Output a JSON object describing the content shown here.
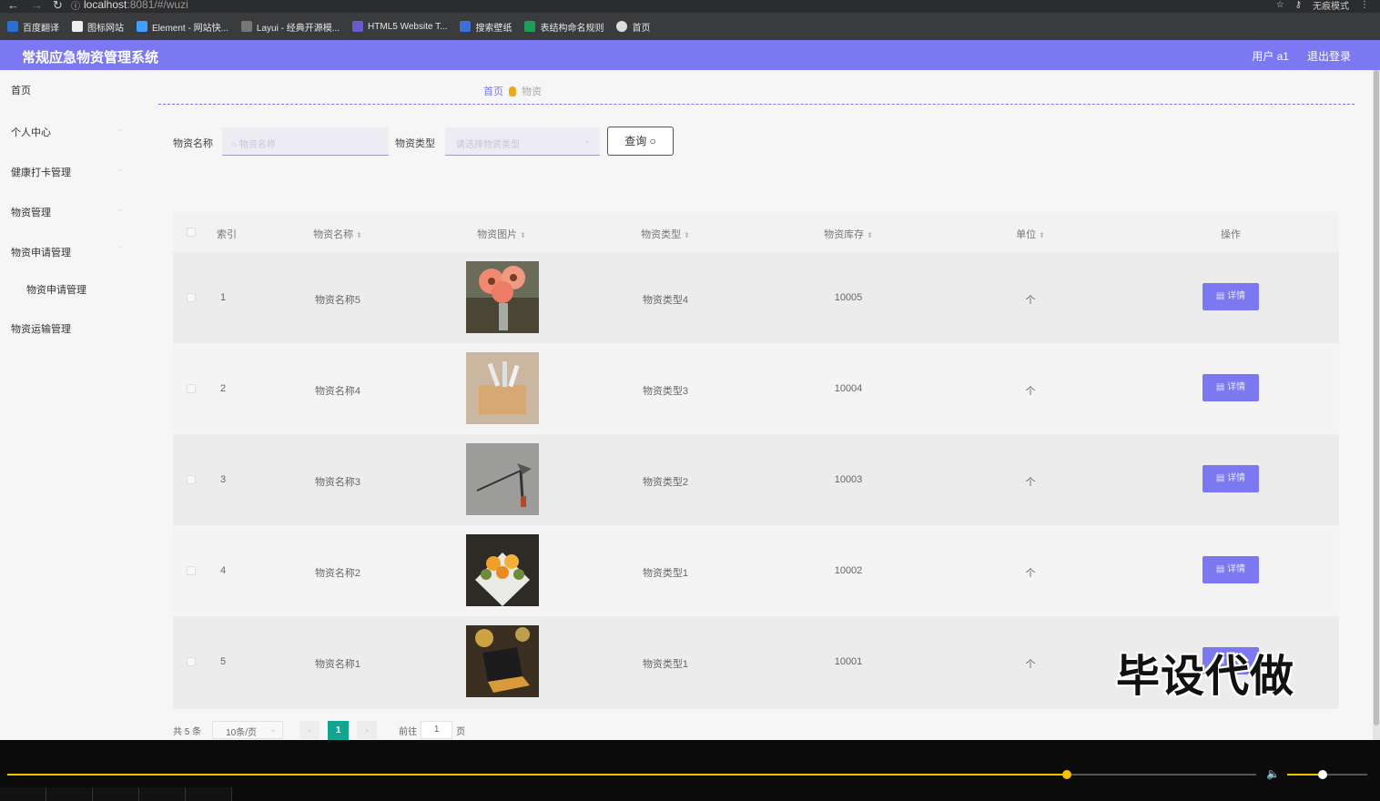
{
  "browser": {
    "url_host": "localhost",
    "url_rest": ":8081/#/wuzi",
    "incognito_label": "无痕模式",
    "bookmarks": [
      {
        "label": "百度翻译",
        "color": "#2a6fd6"
      },
      {
        "label": "图标网站",
        "color": "#222222"
      },
      {
        "label": "Element - 网站快...",
        "color": "#409eff"
      },
      {
        "label": "Layui - 经典开源模...",
        "color": "#444444"
      },
      {
        "label": "HTML5 Website T...",
        "color": "#6a5acd"
      },
      {
        "label": "搜索壁纸",
        "color": "#3d6fd8"
      },
      {
        "label": "表结构命名规则",
        "color": "#1e9e5a"
      },
      {
        "label": "首页",
        "color": "#666666"
      }
    ]
  },
  "header": {
    "title": "常规应急物资管理系统",
    "user": "用户 a1",
    "logout": "退出登录",
    "accent": "#7b78f1"
  },
  "sidebar": {
    "items": [
      {
        "label": "首页"
      },
      {
        "label": "个人中心"
      },
      {
        "label": "健康打卡管理"
      },
      {
        "label": "物资管理"
      },
      {
        "label": "物资申请管理"
      },
      {
        "label": "物资申请管理"
      },
      {
        "label": "物资运输管理"
      }
    ]
  },
  "breadcrumb": {
    "home": "首页",
    "current": "物资"
  },
  "search": {
    "name_label": "物资名称",
    "name_placeholder": "物资名称",
    "type_label": "物资类型",
    "type_placeholder": "请选择物资类型",
    "query_label": "查询"
  },
  "table": {
    "headers": [
      "索引",
      "物资名称",
      "物资图片",
      "物资类型",
      "物资库存",
      "单位",
      "操作"
    ],
    "rows": [
      {
        "index": "1",
        "name": "物资名称5",
        "image": "flowers-in-vase",
        "type": "物资类型4",
        "stock": "10005",
        "unit": "个",
        "action": "详情"
      },
      {
        "index": "2",
        "name": "物资名称4",
        "image": "wooden-tool-box",
        "type": "物资类型3",
        "stock": "10004",
        "unit": "个",
        "action": "详情"
      },
      {
        "index": "3",
        "name": "物资名称3",
        "image": "pruning-shears",
        "type": "物资类型2",
        "stock": "10003",
        "unit": "个",
        "action": "详情"
      },
      {
        "index": "4",
        "name": "物资名称2",
        "image": "flower-bouquet",
        "type": "物资类型1",
        "stock": "10002",
        "unit": "个",
        "action": "详情"
      },
      {
        "index": "5",
        "name": "物资名称1",
        "image": "laptop-desk",
        "type": "物资类型1",
        "stock": "10001",
        "unit": "个",
        "action": "详情"
      }
    ]
  },
  "pagination": {
    "total": "共 5 条",
    "page_size": "10条/页",
    "current_page": "1",
    "goto_label": "前往",
    "goto_value": "1",
    "page_suffix": "页"
  },
  "watermark": "毕设代做",
  "player": {
    "progress": 0.77,
    "volume": 0.5
  }
}
